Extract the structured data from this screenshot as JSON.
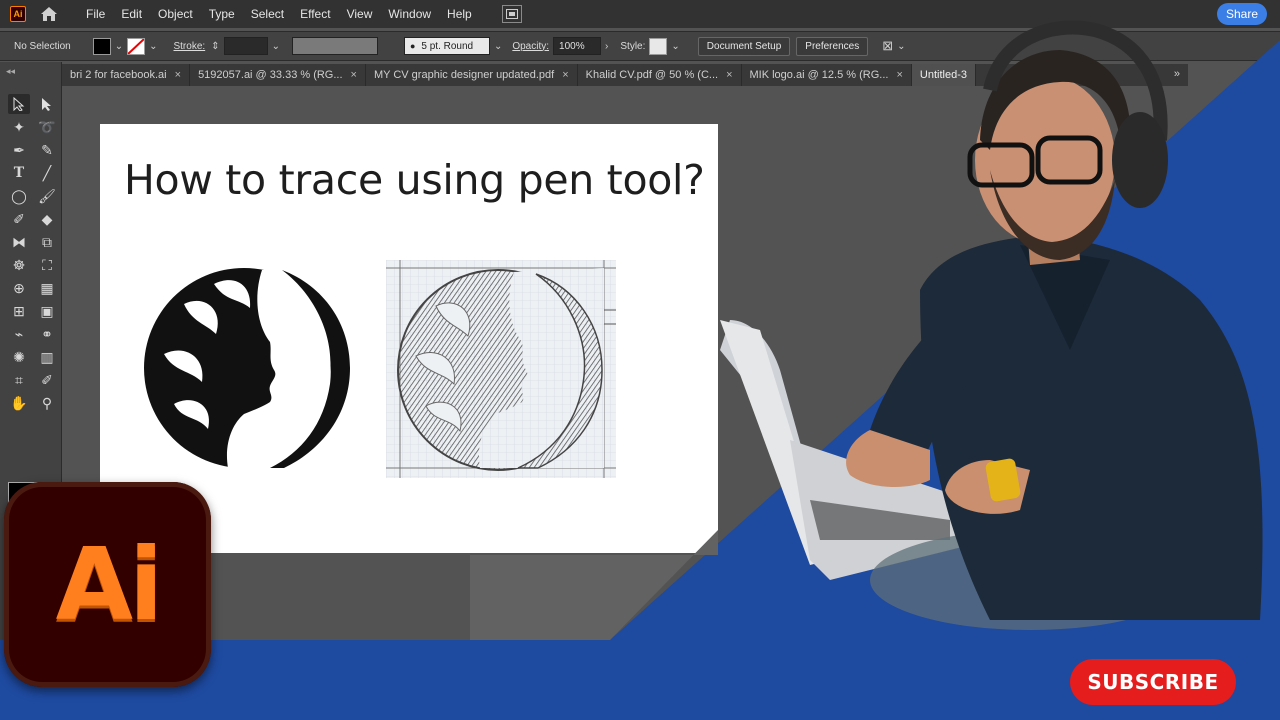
{
  "app": {
    "logo_text": "Ai",
    "menus": [
      "File",
      "Edit",
      "Object",
      "Type",
      "Select",
      "Effect",
      "View",
      "Window",
      "Help"
    ],
    "share_label": "Share"
  },
  "controlbar": {
    "selection": "No Selection",
    "stroke_label": "Stroke:",
    "brush": "5 pt. Round",
    "opacity_label": "Opacity:",
    "opacity_value": "100%",
    "style_label": "Style:",
    "document_setup": "Document Setup",
    "preferences": "Preferences"
  },
  "tabs": [
    {
      "label": "bri 2 for facebook.ai",
      "close": "×"
    },
    {
      "label": "5192057.ai @ 33.33 % (RG...",
      "close": "×"
    },
    {
      "label": "MY CV graphic designer updated.pdf",
      "close": "×"
    },
    {
      "label": "Khalid CV.pdf @ 50 % (C...",
      "close": "×"
    },
    {
      "label": "MIK logo.ai @ 12.5 % (RG...",
      "close": "×"
    },
    {
      "label": "Untitled-3",
      "close": ""
    }
  ],
  "tabs_more": "»",
  "artboard": {
    "title": "How to trace using pen tool?"
  },
  "overlay": {
    "ai_logo_text": "Ai",
    "subscribe_label": "SUBSCRIBE"
  },
  "colors": {
    "ui_dark": "#323232",
    "panel": "#424242",
    "canvas": "#535353",
    "accent_blue": "#1e4aa0",
    "share_blue": "#3b7ee6",
    "subscribe_red": "#e51d1d",
    "ai_orange": "#ff7f1e"
  }
}
